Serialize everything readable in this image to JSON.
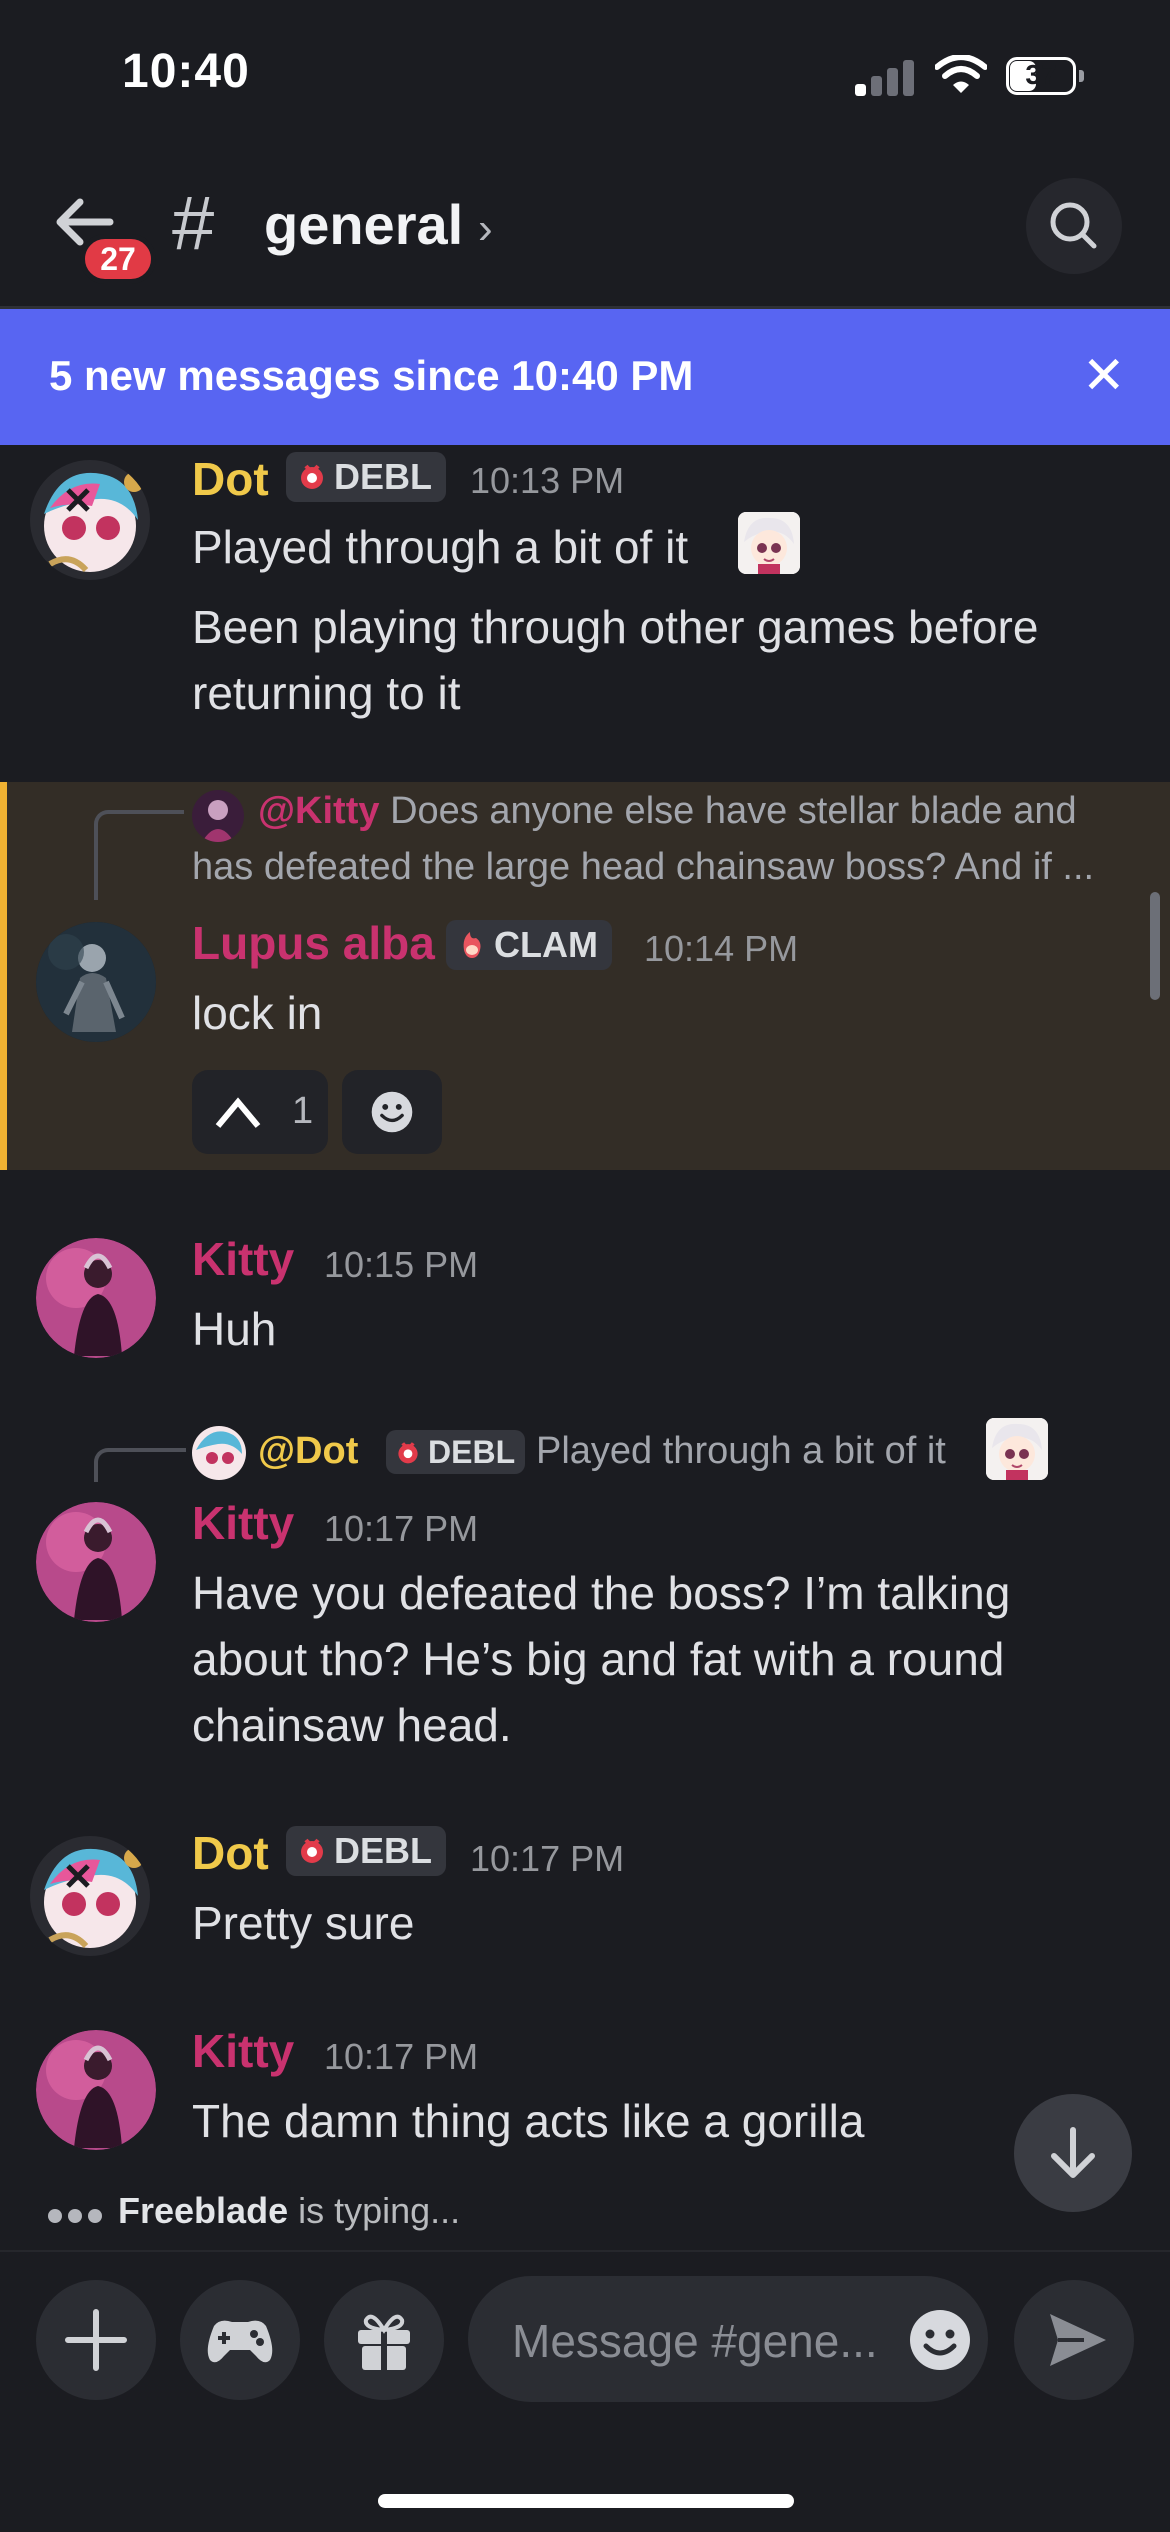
{
  "status_bar": {
    "time": "10:40",
    "battery": "37"
  },
  "header": {
    "unread_count": "27",
    "channel_prefix": "#",
    "channel_name": "general",
    "chevron": "›"
  },
  "new_messages_bar": {
    "text": "5 new messages since 10:40 PM",
    "close": "✕"
  },
  "messages": [
    {
      "author": "Dot",
      "tag": "DEBL",
      "time": "10:13 PM",
      "lines": [
        "Played through a bit of it",
        "Been playing through other games before",
        "returning to it"
      ]
    },
    {
      "reply_to": {
        "mention": "@Kitty",
        "text": "Does anyone else have stellar blade and",
        "text2": "has defeated the large head chainsaw boss? And if ..."
      },
      "author": "Lupus alba",
      "tag": "CLAM",
      "time": "10:14 PM",
      "lines": [
        "lock in"
      ],
      "reaction": {
        "count": "1"
      }
    },
    {
      "author": "Kitty",
      "time": "10:15 PM",
      "lines": [
        "Huh"
      ]
    },
    {
      "reply_to": {
        "mention": "@Dot",
        "tag": "DEBL",
        "text": "Played through a bit of it"
      },
      "author": "Kitty",
      "time": "10:17 PM",
      "lines": [
        "Have you defeated the boss? I’m talking",
        "about tho? He’s big and fat with a round",
        "chainsaw head."
      ]
    },
    {
      "author": "Dot",
      "tag": "DEBL",
      "time": "10:17 PM",
      "lines": [
        "Pretty sure"
      ]
    },
    {
      "author": "Kitty",
      "time": "10:17 PM",
      "lines": [
        "The damn thing acts like a gorilla"
      ]
    }
  ],
  "typing": {
    "user": "Freeblade",
    "suffix": " is typing..."
  },
  "composer": {
    "placeholder": "Message #gene..."
  },
  "colors": {
    "accent": "#5865f2",
    "highlight": "#f0b232",
    "dot_name": "#f0c94a",
    "kitty_name": "#c9326f"
  }
}
